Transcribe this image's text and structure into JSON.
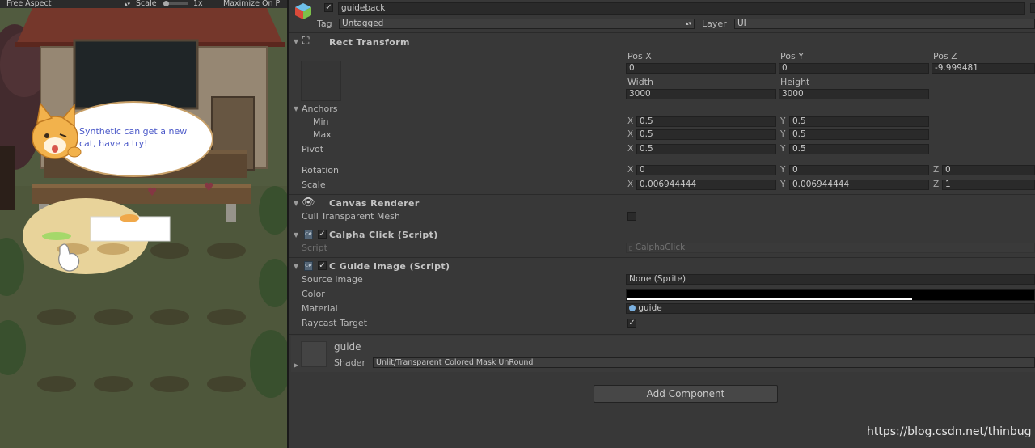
{
  "game_view": {
    "aspect": "Free Aspect",
    "scale_label": "Scale",
    "scale_value": "1x",
    "maximize_label": "Maximize On Pl",
    "bubble_text": "Synthetic can get a new cat, have a try!"
  },
  "object": {
    "active": true,
    "name": "guideback",
    "tag_label": "Tag",
    "tag_value": "Untagged",
    "layer_label": "Layer",
    "layer_value": "UI"
  },
  "rect_transform": {
    "title": "Rect Transform",
    "pos_x_label": "Pos X",
    "pos_x": "0",
    "pos_y_label": "Pos Y",
    "pos_y": "0",
    "pos_z_label": "Pos Z",
    "pos_z": "-9.999481",
    "width_label": "Width",
    "width": "3000",
    "height_label": "Height",
    "height": "3000",
    "anchors_label": "Anchors",
    "min_label": "Min",
    "min_x": "0.5",
    "min_y": "0.5",
    "max_label": "Max",
    "max_x": "0.5",
    "max_y": "0.5",
    "pivot_label": "Pivot",
    "pivot_x": "0.5",
    "pivot_y": "0.5",
    "rotation_label": "Rotation",
    "rot_x": "0",
    "rot_y": "0",
    "rot_z": "0",
    "scale_label": "Scale",
    "scale_x": "0.006944444",
    "scale_y": "0.006944444",
    "scale_z": "1",
    "axis_x": "X",
    "axis_y": "Y",
    "axis_z": "Z"
  },
  "canvas_renderer": {
    "title": "Canvas Renderer",
    "cull_label": "Cull Transparent Mesh",
    "cull_checked": false
  },
  "calpha_click": {
    "enabled": true,
    "title": "Calpha Click (Script)",
    "script_label": "Script",
    "script_value": "CalphaClick"
  },
  "guide_image": {
    "enabled": true,
    "title": "C Guide Image (Script)",
    "source_image_label": "Source Image",
    "source_image_value": "None (Sprite)",
    "color_label": "Color",
    "color_value": "#000000",
    "alpha_fraction": 0.7,
    "material_label": "Material",
    "material_value": "guide",
    "raycast_label": "Raycast Target",
    "raycast_checked": true
  },
  "material_panel": {
    "name": "guide",
    "shader_label": "Shader",
    "shader_value": "Unlit/Transparent Colored Mask UnRound"
  },
  "add_component_label": "Add Component",
  "watermark": "https://blog.csdn.net/thinbug"
}
